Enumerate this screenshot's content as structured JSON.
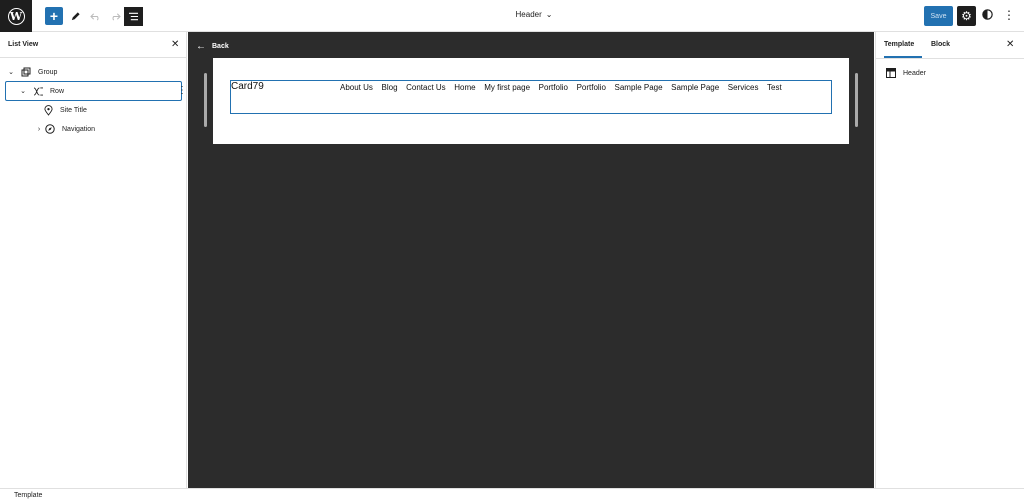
{
  "topbar": {
    "logo_letter": "W",
    "add_label": "+",
    "doc_title": "Header",
    "save_label": "Save"
  },
  "list_view": {
    "title": "List View",
    "items": [
      {
        "label": "Group",
        "icon": "group-icon"
      },
      {
        "label": "Row",
        "icon": "row-icon",
        "selected": true
      },
      {
        "label": "Site Title",
        "icon": "map-pin-icon"
      },
      {
        "label": "Navigation",
        "icon": "compass-icon"
      }
    ]
  },
  "canvas": {
    "back_label": "Back",
    "site_title": "Card79",
    "nav_items": [
      "About Us",
      "Blog",
      "Contact Us",
      "Home",
      "My first page",
      "Portfolio",
      "Portfolio",
      "Sample Page",
      "Sample Page",
      "Services",
      "Test"
    ]
  },
  "sidebar": {
    "tabs": [
      {
        "label": "Template",
        "active": true
      },
      {
        "label": "Block",
        "active": false
      }
    ],
    "template_name": "Header"
  },
  "footer": {
    "breadcrumb": "Template"
  },
  "colors": {
    "accent": "#2271b1",
    "canvas_bg": "#2c2c2c",
    "dark": "#1e1e1e"
  }
}
